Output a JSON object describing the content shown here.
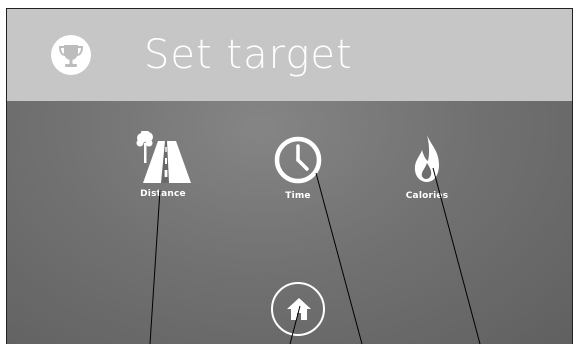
{
  "header": {
    "title": "Set target",
    "icon": "trophy-icon"
  },
  "options": [
    {
      "label": "Distance",
      "icon": "road-tree-icon"
    },
    {
      "label": "Time",
      "icon": "clock-icon"
    },
    {
      "label": "Calories",
      "icon": "flame-icon"
    }
  ],
  "home": {
    "icon": "home-icon"
  },
  "colors": {
    "header_bg": "#c6c6c6",
    "body_bg": "#727272",
    "foreground": "#ffffff",
    "leader_line": "#000000"
  }
}
